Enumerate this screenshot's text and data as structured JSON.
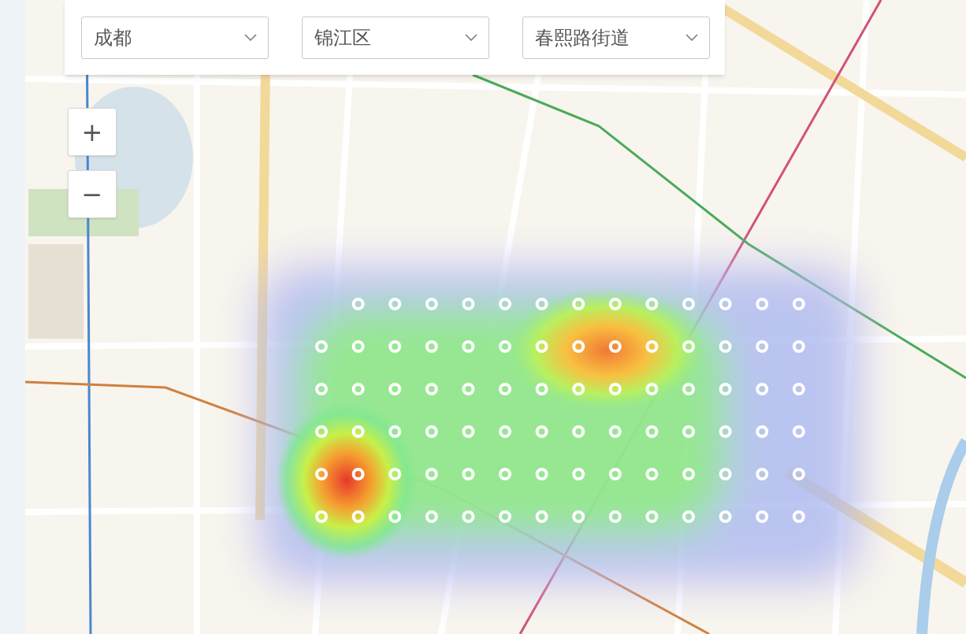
{
  "filters": [
    {
      "value": "成都"
    },
    {
      "value": "锦江区"
    },
    {
      "value": "春熙路街道"
    }
  ],
  "zoom_controls": [
    {
      "label": "+"
    },
    {
      "label": "−"
    }
  ]
}
